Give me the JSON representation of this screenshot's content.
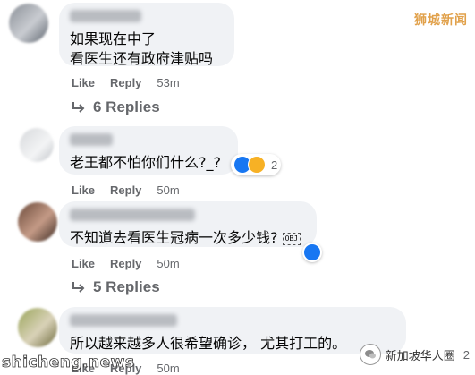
{
  "watermarks": {
    "top_right": "狮城新闻",
    "bottom_left": "shicheng.news",
    "bottom_right": "新加坡华人圈"
  },
  "comments": [
    {
      "lines": [
        "如果现在中了",
        "看医生还有政府津贴吗"
      ],
      "like_label": "Like",
      "reply_label": "Reply",
      "time": "53m",
      "replies_label": "6 Replies"
    },
    {
      "lines": [
        "老王都不怕你们什么?_?"
      ],
      "like_label": "Like",
      "reply_label": "Reply",
      "time": "50m",
      "reaction_count": "2",
      "reaction_icons": [
        "like-emoji",
        "haha-emoji"
      ]
    },
    {
      "lines": [
        "不知道去看医生冠病一次多少钱?"
      ],
      "inline_obj": "OBJ",
      "like_label": "Like",
      "reply_label": "Reply",
      "time": "50m",
      "replies_label": "5 Replies",
      "reaction_icons": [
        "like-emoji"
      ]
    },
    {
      "lines": [
        "所以越来越多人很希望确诊，  尤其打工的。"
      ],
      "like_label": "Like",
      "reply_label": "Reply",
      "time": "50m",
      "reaction_count": "2"
    }
  ],
  "colors": {
    "bubble": "#f0f2f5",
    "meta_text": "#65676b",
    "like_blue": "#1877f2",
    "haha_yellow": "#f7b125",
    "watermark_orange": "#e1a14b"
  }
}
